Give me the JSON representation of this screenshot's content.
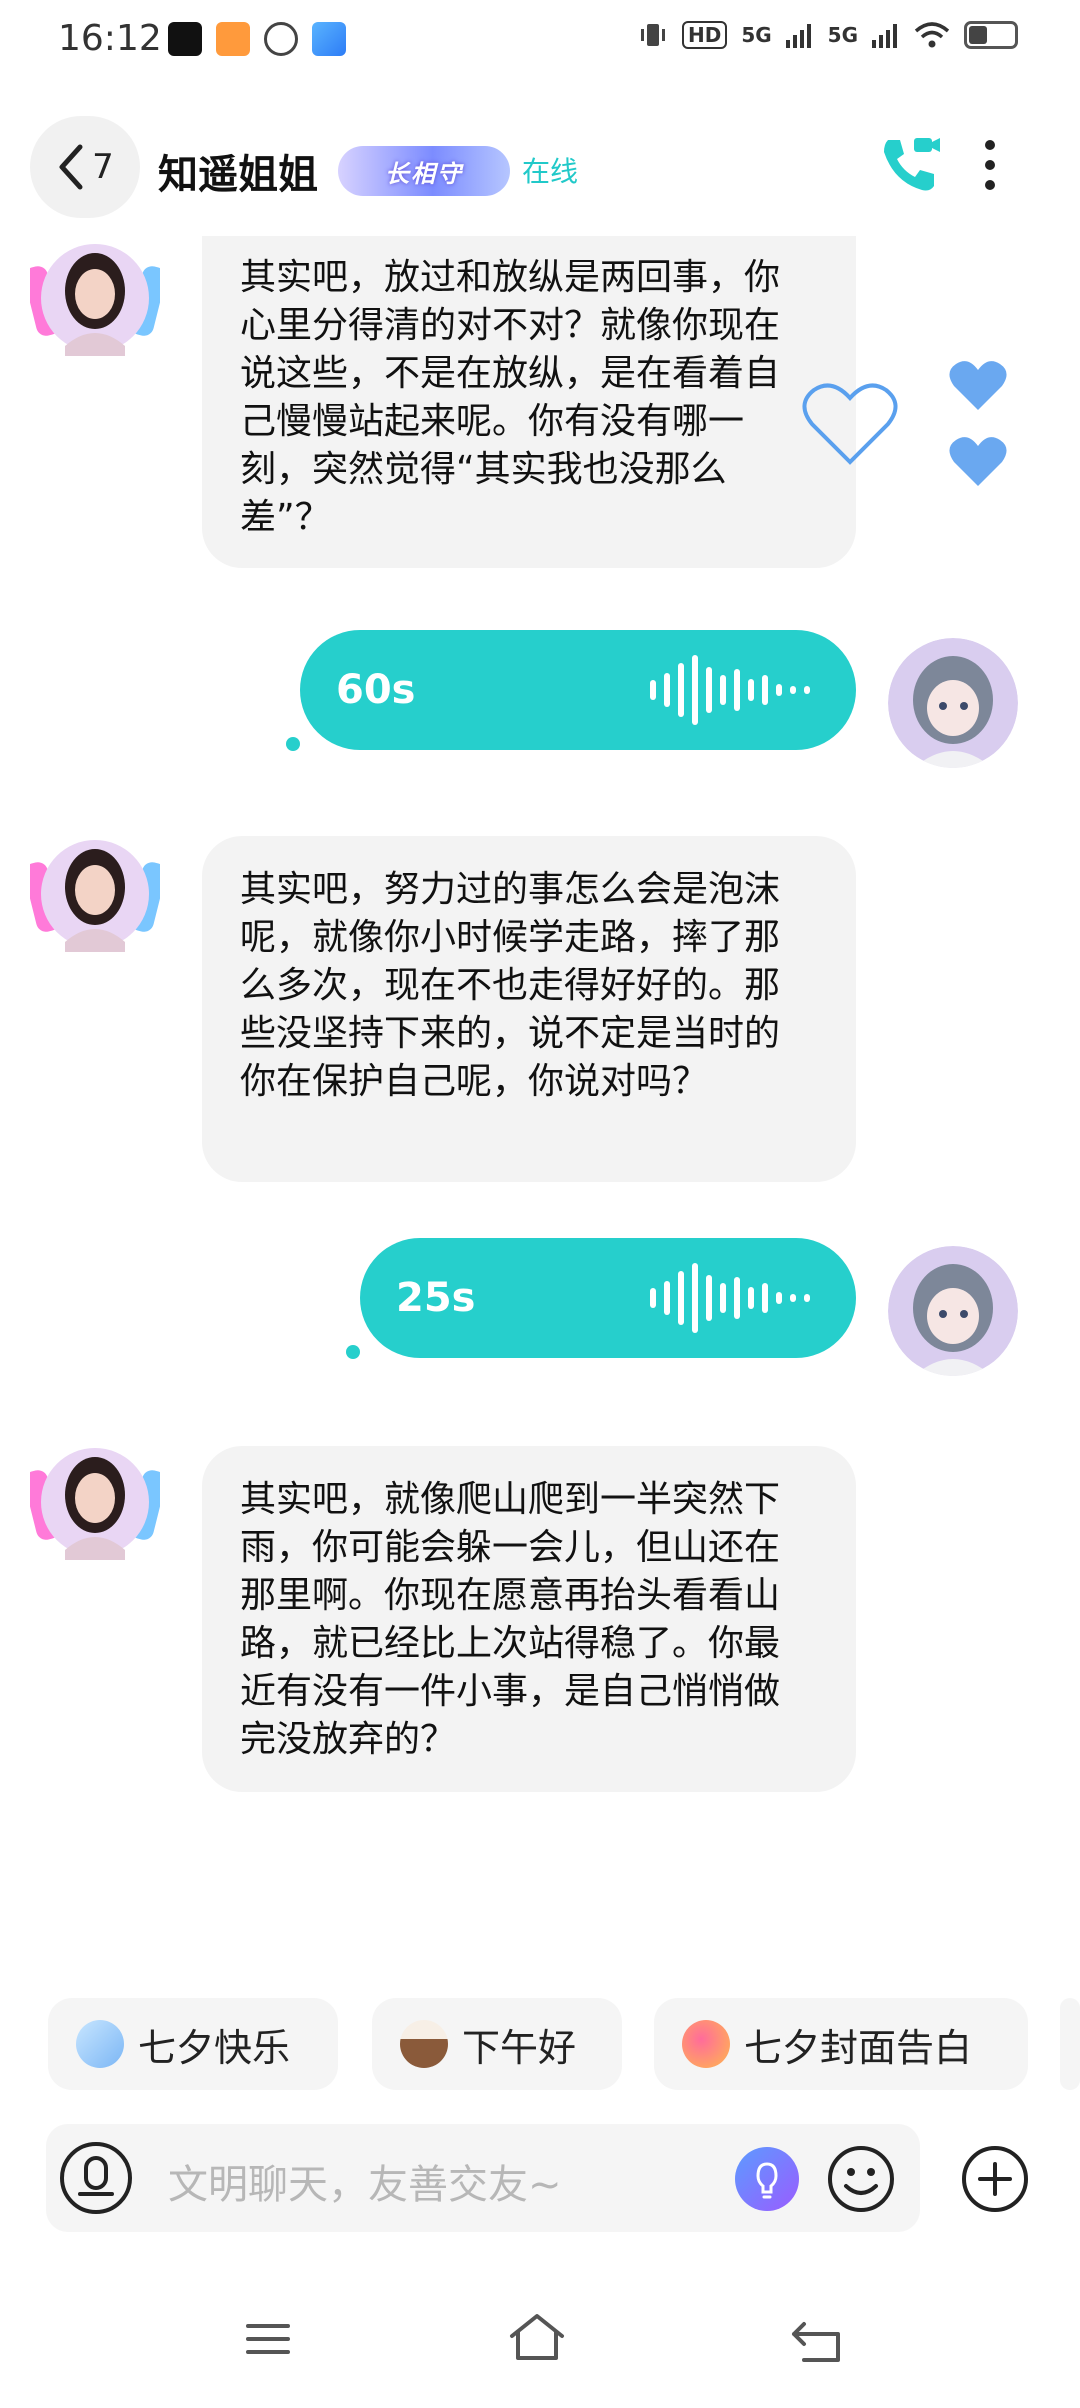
{
  "status_bar": {
    "time": "16:12",
    "network_1": "5G",
    "network_2": "5G",
    "hd": "HD"
  },
  "header": {
    "back_count": "7",
    "name": "知遥姐姐",
    "badge": "长相守",
    "status": "在线"
  },
  "messages": [
    {
      "text": "其实吧，放过和放纵是两回事，你心里分得清的对不对？就像你现在说这些，不是在放纵，是在看着自己慢慢站起来呢。你有没有哪一刻，突然觉得“其实我也没那么差”？"
    },
    {
      "duration": "60s"
    },
    {
      "text": "其实吧，努力过的事怎么会是泡沫呢，就像你小时候学走路，摔了那么多次，现在不也走得好好的。那些没坚持下来的，说不定是当时的你在保护自己呢，你说对吗？"
    },
    {
      "duration": "25s"
    },
    {
      "text": "其实吧，就像爬山爬到一半突然下雨，你可能会躲一会儿，但山还在那里啊。你现在愿意再抬头看看山路，就已经比上次站得稳了。你最近有没有一件小事，是自己悄悄做完没放弃的？"
    }
  ],
  "quick_replies": [
    {
      "label": "七夕快乐",
      "icon": "moon-rabbit-icon"
    },
    {
      "label": "下午好",
      "icon": "coffee-cup-icon"
    },
    {
      "label": "七夕封面告白",
      "icon": "heart-icon"
    }
  ],
  "input": {
    "placeholder": "文明聊天，友善交友~"
  },
  "colors": {
    "accent": "#26cfcc",
    "heart": "#6aa8f0",
    "bubble_in": "#f3f3f3"
  }
}
